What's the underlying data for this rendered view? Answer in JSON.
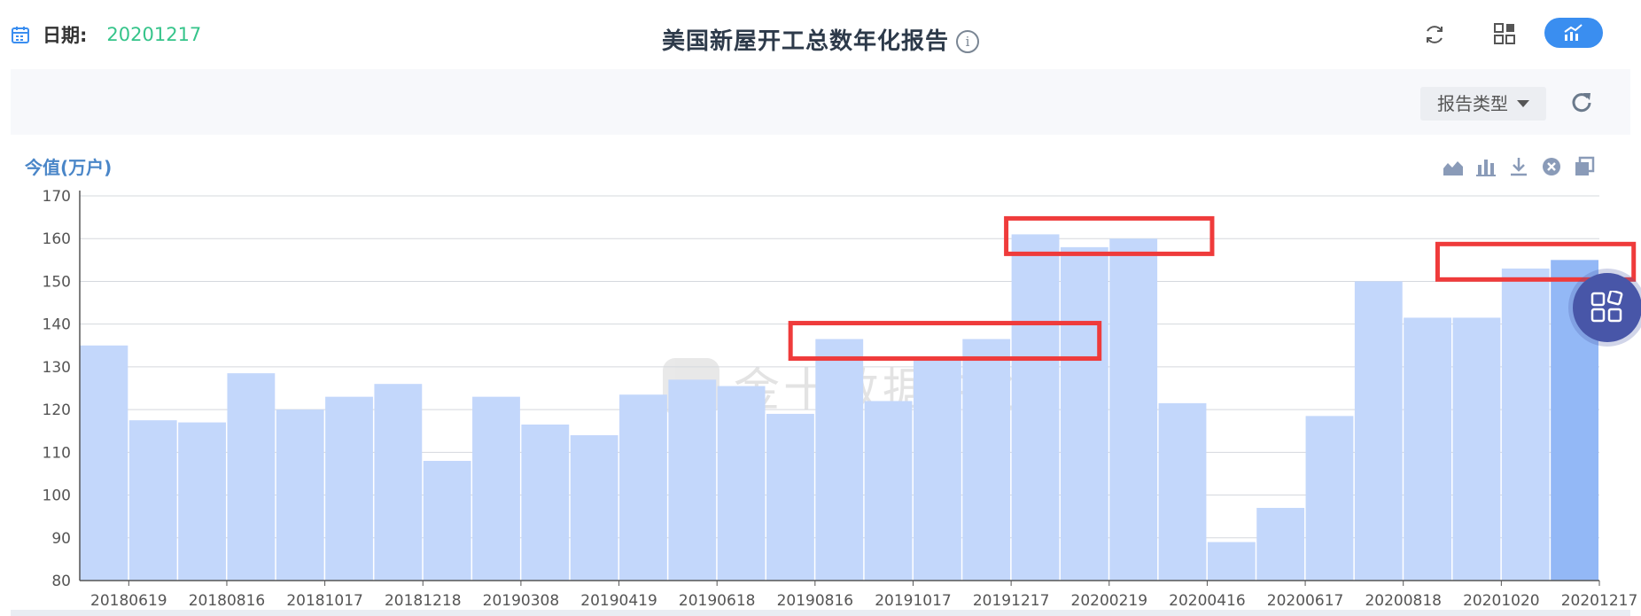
{
  "header": {
    "date_label": "日期:",
    "date_value": "20201217",
    "title": "美国新屋开工总数年化报告",
    "info_glyph": "i",
    "icons": [
      "calendar-icon",
      "refresh-icon",
      "grid-icon",
      "chart-toggle-icon"
    ]
  },
  "filter": {
    "report_type_label": "报告类型"
  },
  "toolbox": {
    "icons": [
      "area-chart-icon",
      "bar-chart-icon",
      "download-icon",
      "clear-icon",
      "copy-icon"
    ]
  },
  "watermark": {
    "text": "金十数据中心"
  },
  "colors": {
    "accent": "#3a8ef0",
    "date": "#35c48a",
    "bar": "#c3d7fb",
    "bar_highlight": "#93b8f6",
    "annotation": "#ef3b3b",
    "float_button": "#4856a8"
  },
  "chart_data": {
    "type": "bar",
    "unit_label": "今值(万户)",
    "ylim": [
      80,
      170
    ],
    "yticks": [
      80,
      90,
      100,
      110,
      120,
      130,
      140,
      150,
      160,
      170
    ],
    "grid": true,
    "xtick_labels": [
      "20180619",
      "20180816",
      "20181017",
      "20181218",
      "20190308",
      "20190419",
      "20190618",
      "20190816",
      "20191017",
      "20191217",
      "20200219",
      "20200416",
      "20200617",
      "20200818",
      "20201020",
      "20201217"
    ],
    "values": [
      135,
      117.5,
      117,
      128.5,
      120,
      123,
      126,
      108,
      123,
      116.5,
      114,
      123.5,
      127,
      125.5,
      119,
      136.5,
      122,
      131.5,
      136.5,
      161,
      158,
      160,
      121.5,
      89,
      97,
      118.5,
      150,
      141.5,
      141.5,
      153,
      155
    ],
    "highlight_index": 30,
    "annotation_boxes_around_values": [
      [
        136.5,
        136.5
      ],
      [
        161,
        160
      ],
      [
        153,
        155
      ]
    ]
  }
}
